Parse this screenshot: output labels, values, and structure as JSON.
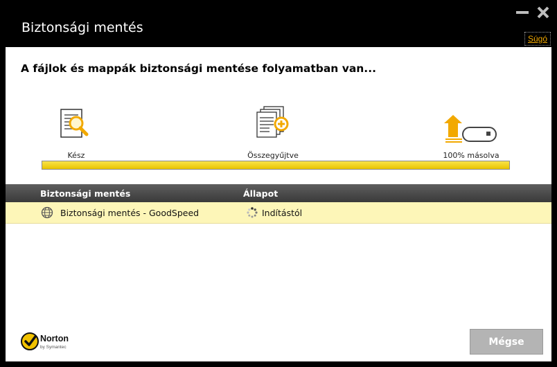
{
  "window": {
    "title": "Biztonsági mentés",
    "help_label": "Súgó"
  },
  "main": {
    "heading": "A fájlok és mappák biztonsági mentése folyamatban van...",
    "steps": [
      {
        "label": "Kész",
        "icon": "document-search-icon"
      },
      {
        "label": "Összegyűjtve",
        "icon": "documents-add-icon"
      },
      {
        "label": "100% másolva",
        "icon": "upload-drive-icon"
      }
    ],
    "progress": {
      "value": 1.0
    }
  },
  "table": {
    "columns": [
      "Biztonsági mentés",
      "Állapot"
    ],
    "rows": [
      {
        "name": "Biztonsági mentés - GoodSpeed",
        "status": "Indítástól",
        "icon": "globe-icon",
        "status_icon": "spinner-icon"
      }
    ]
  },
  "footer": {
    "brand": "Norton",
    "brand_sub": "by Symantec",
    "cancel_label": "Mégse"
  },
  "colors": {
    "accent": "#f2a900",
    "progress": "#f0cf1a",
    "row_highlight": "#fdf6b8"
  }
}
